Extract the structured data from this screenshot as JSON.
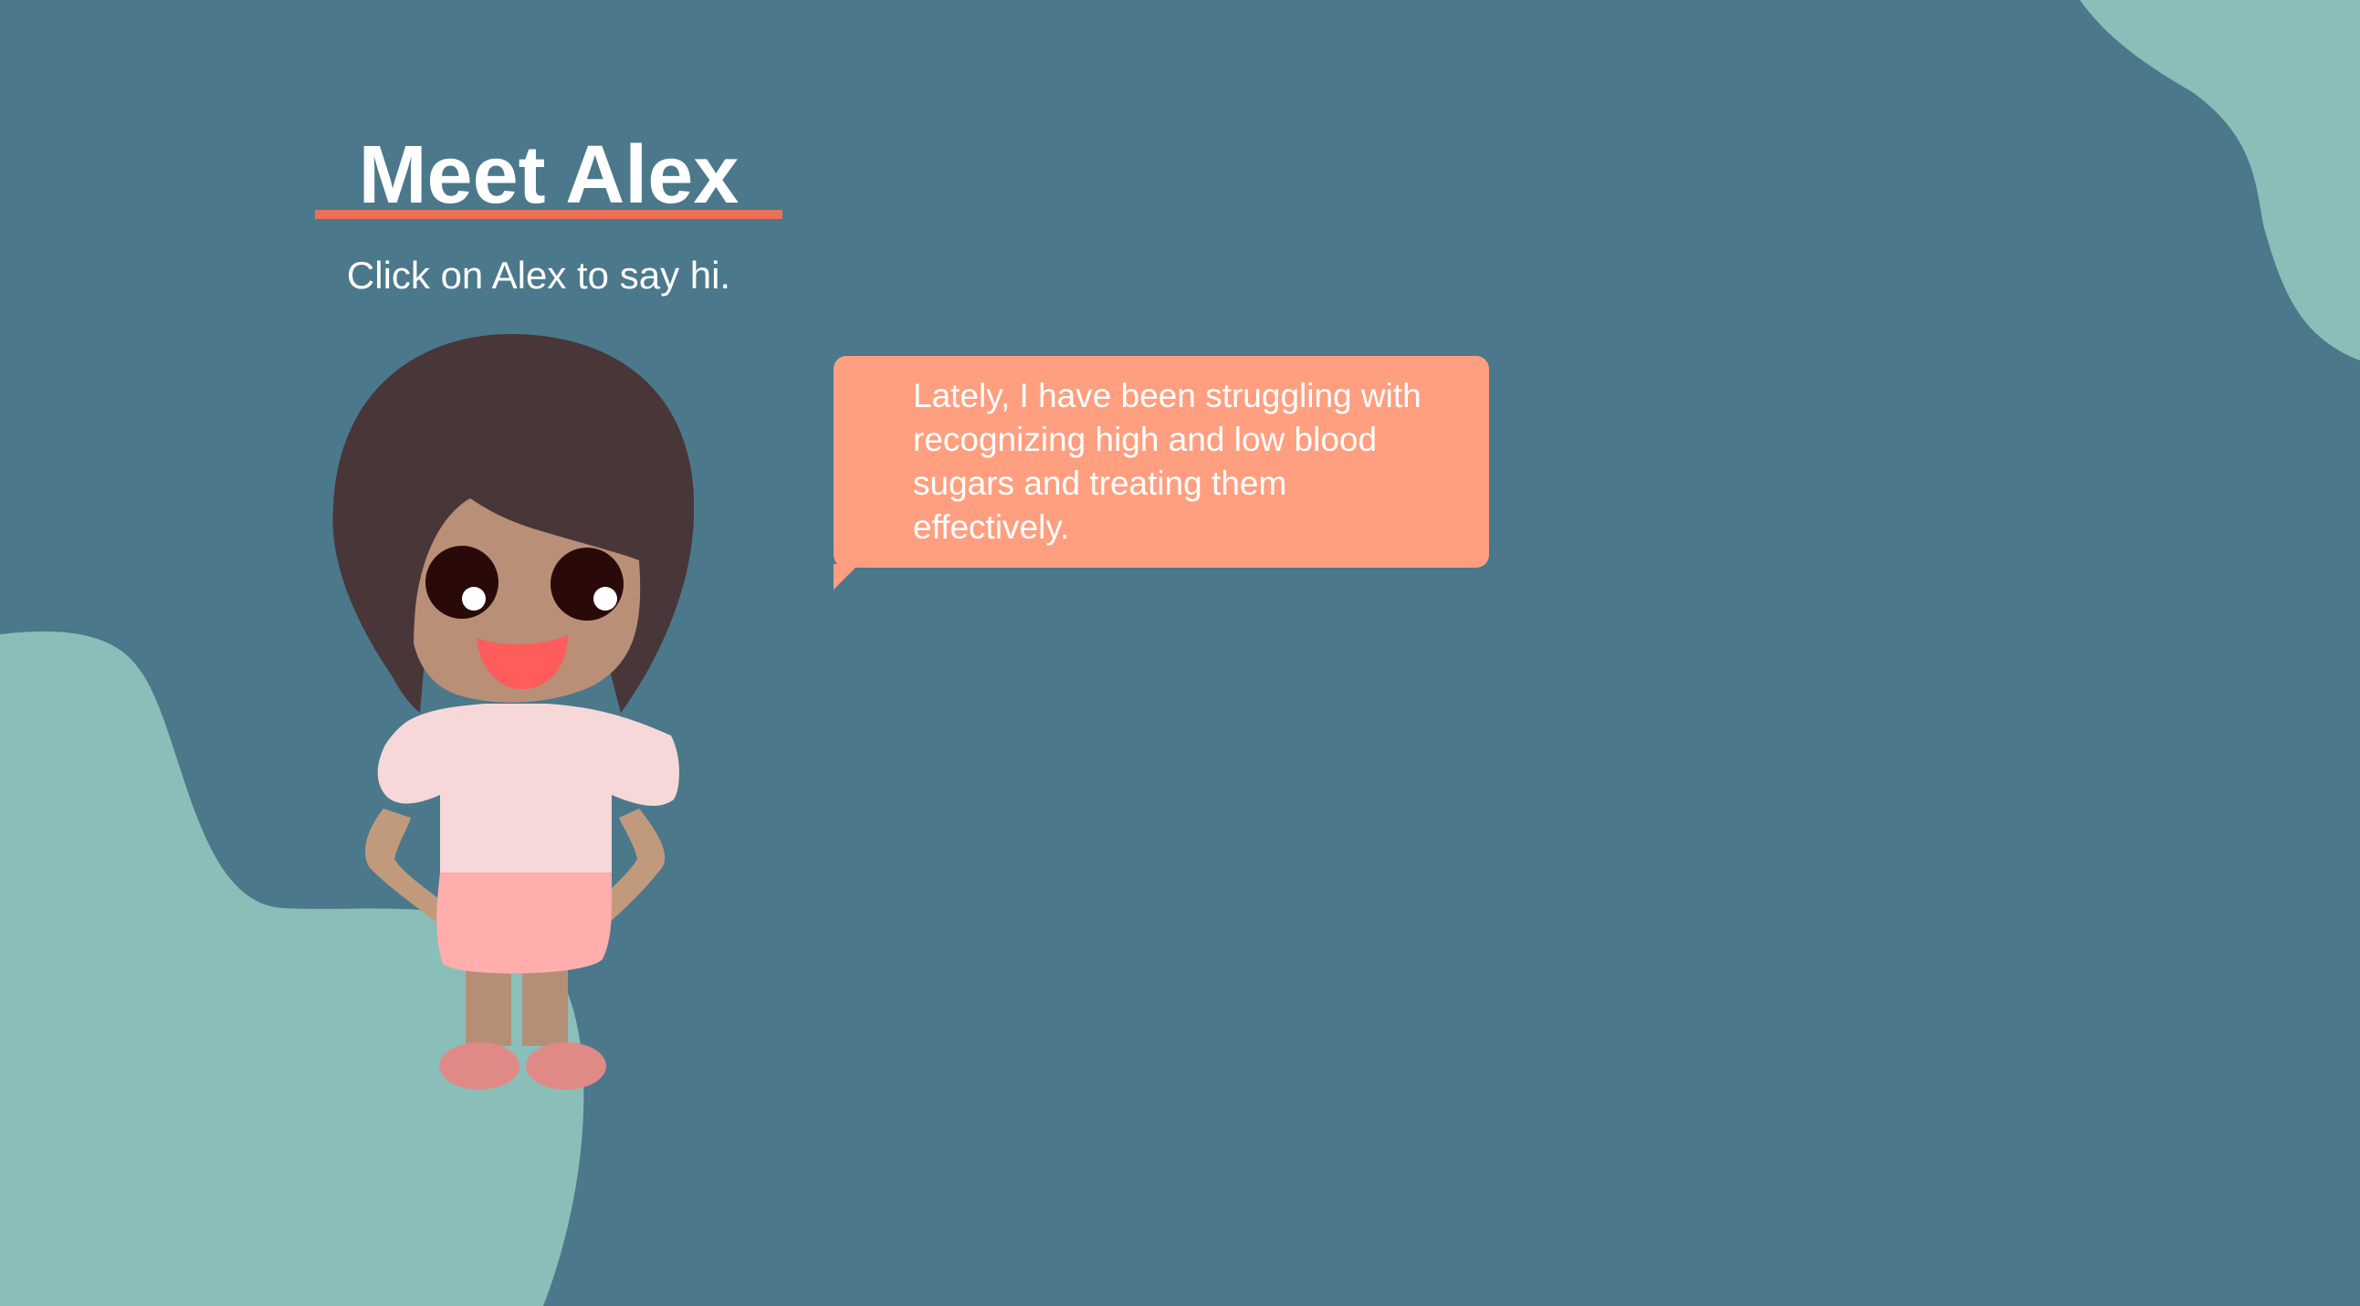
{
  "page": {
    "title": "Meet Alex",
    "subtitle": "Click on Alex to say hi."
  },
  "character": {
    "name": "Alex"
  },
  "speech_bubble": {
    "text": "Lately, I have been struggling with recognizing high and low blood sugars and treating them effectively."
  },
  "colors": {
    "background": "#4b788b",
    "blob": "#89bfb8",
    "accent_underline": "#ea7157",
    "bubble": "#ff9f80",
    "text": "#ffffff"
  }
}
